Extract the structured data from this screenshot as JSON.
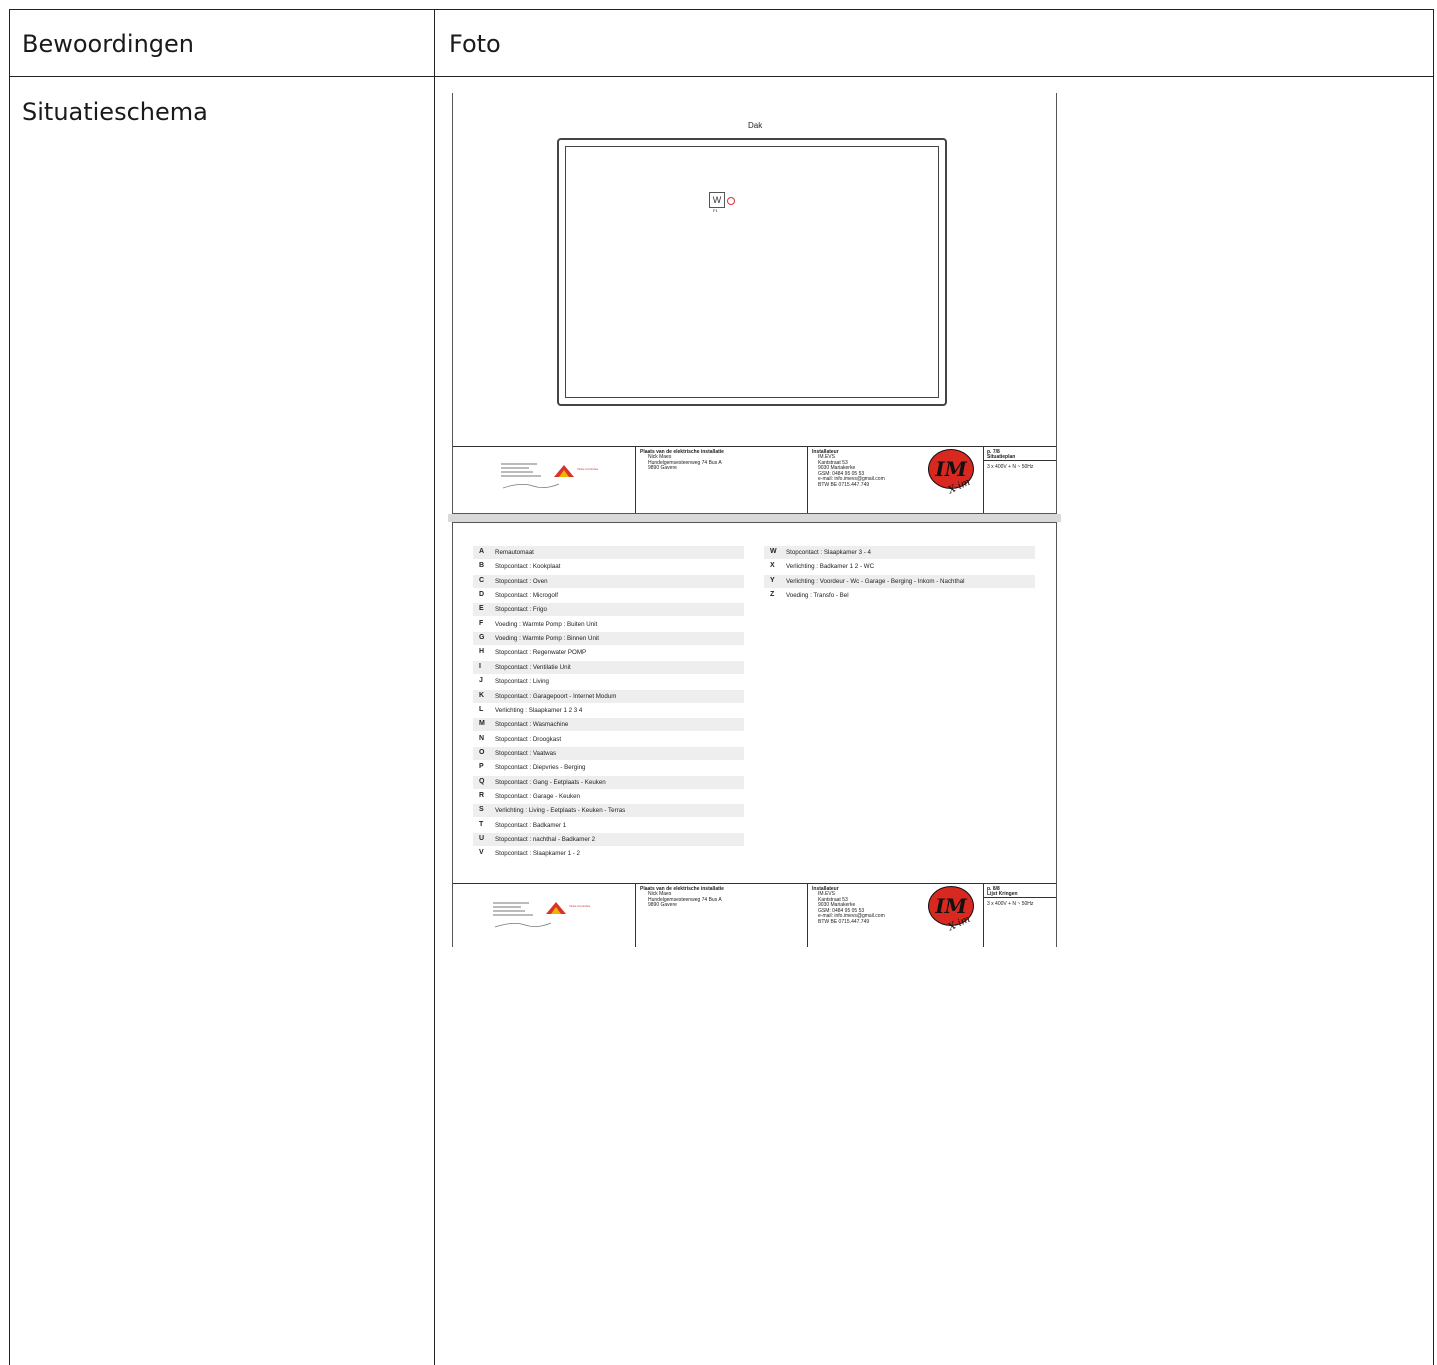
{
  "table": {
    "header_col1": "Bewoordingen",
    "header_col2": "Foto",
    "row1_label": "Situatieschema"
  },
  "page1": {
    "roof_label": "Dak",
    "symbol_label": "W",
    "symbol_sub": "F1",
    "cartouche": {
      "place_title": "Plaats van de elektrische installatie",
      "place_lines": [
        "Nick Maes",
        "Hundelgemsesteenweg 74 Bus A",
        "9890 Gavere"
      ],
      "installer_title": "Installateur",
      "installer_lines": [
        "IM.EVS",
        "Kantstraat 53",
        "9030 Mariakerke",
        "GSM: 0484 95 05 53",
        "e-mail: info.imevs@gmail.com",
        "BTW BE 0715.447.749"
      ],
      "page_no": "p. 7/8",
      "page_title": "Situatieplan",
      "supply": "3 x 400V + N ~ 50Hz",
      "logo_text": "IM",
      "sign_text": "X-im",
      "small_logo_text": "Vinke Controles"
    }
  },
  "page2": {
    "legend_left": [
      {
        "k": "A",
        "v": "Remautomaat"
      },
      {
        "k": "B",
        "v": "Stopcontact : Kookplaat"
      },
      {
        "k": "C",
        "v": "Stopcontact : Oven"
      },
      {
        "k": "D",
        "v": "Stopcontact : Microgolf"
      },
      {
        "k": "E",
        "v": "Stopcontact : Frigo"
      },
      {
        "k": "F",
        "v": "Voeding : Warmte Pomp : Buiten Unit"
      },
      {
        "k": "G",
        "v": "Voeding : Warmte Pomp : Binnen Unit"
      },
      {
        "k": "H",
        "v": "Stopcontact : Regenwater POMP"
      },
      {
        "k": "I",
        "v": "Stopcontact : Ventilatie Unit"
      },
      {
        "k": "J",
        "v": "Stopcontact : Living"
      },
      {
        "k": "K",
        "v": "Stopcontact : Garagepoort - Internet Modum"
      },
      {
        "k": "L",
        "v": "Verlichting : Slaapkamer 1 2 3 4"
      },
      {
        "k": "M",
        "v": "Stopcontact : Wasmachine"
      },
      {
        "k": "N",
        "v": "Stopcontact : Droogkast"
      },
      {
        "k": "O",
        "v": "Stopcontact : Vaatwas"
      },
      {
        "k": "P",
        "v": "Stopcontact : Diepvries - Berging"
      },
      {
        "k": "Q",
        "v": "Stopcontact : Gang - Eetplaats - Keuken"
      },
      {
        "k": "R",
        "v": "Stopcontact : Garage - Keuken"
      },
      {
        "k": "S",
        "v": "Verlichting : Living - Eetplaats - Keuken - Terras"
      },
      {
        "k": "T",
        "v": "Stopcontact : Badkamer 1"
      },
      {
        "k": "U",
        "v": "Stopcontact : nachthal - Badkamer 2"
      },
      {
        "k": "V",
        "v": "Stopcontact : Slaapkamer 1 - 2"
      }
    ],
    "legend_right": [
      {
        "k": "W",
        "v": "Stopcontact : Slaapkamer 3 - 4"
      },
      {
        "k": "X",
        "v": "Verlichting : Badkamer 1 2 - WC"
      },
      {
        "k": "Y",
        "v": "Verlichting : Voordeur - Wc - Garage - Berging - Inkom - Nachthal"
      },
      {
        "k": "Z",
        "v": "Voeding : Transfo - Bel"
      }
    ],
    "cartouche": {
      "place_title": "Plaats van de elektrische installatie",
      "place_lines": [
        "Nick Maes",
        "Hundelgemsesteenweg 74 Bus A",
        "9890 Gavere"
      ],
      "installer_title": "Installateur",
      "installer_lines": [
        "IM.EVS",
        "Kantstraat 53",
        "9030 Mariakerke",
        "GSM: 0484 95 05 53",
        "e-mail: info.imevs@gmail.com",
        "BTW BE 0715.447.749"
      ],
      "page_no": "p. 8/8",
      "page_title": "Lijst Kringen",
      "supply": "3 x 400V + N ~ 50Hz",
      "logo_text": "IM",
      "sign_text": "X-im",
      "small_logo_text": "Vinke Controles"
    }
  }
}
